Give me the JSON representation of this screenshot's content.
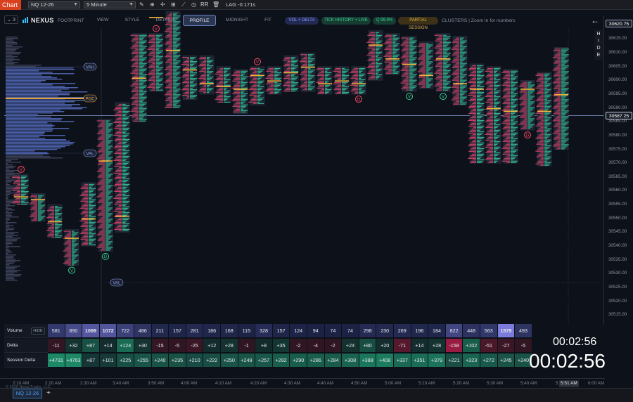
{
  "topbar": {
    "chart_tab": "Chart",
    "symbol": "NQ 12-26",
    "interval": "5 Minute",
    "lag": "LAG -0.171s",
    "rr": "RR"
  },
  "toolbar": {
    "version_btn": "3",
    "brand": "NEXUS",
    "brand_sub": "FOOTPRINT",
    "buttons": [
      {
        "label": "VIEW",
        "active": false
      },
      {
        "label": "STYLE",
        "active": false
      },
      {
        "label": "DETAILS",
        "active": false
      },
      {
        "label": "PROFILE",
        "active": true
      },
      {
        "label": "MIDNIGHT",
        "active": false
      },
      {
        "label": "FIT",
        "active": false
      }
    ],
    "pills": [
      {
        "label": "VOL + DELTA",
        "color": "#6a78ff",
        "bg": "#232a52"
      },
      {
        "label": "TICK HISTORY + LIVE",
        "color": "#3fd39a",
        "bg": "#173d33"
      },
      {
        "label": "Q 99.9%",
        "color": "#3fd39a",
        "bg": "#173d33"
      },
      {
        "label": "PARTIAL SESSION",
        "color": "#e3b24a",
        "bg": "#3d3218"
      }
    ],
    "clusters_text": "CLUSTERS | Zoom in for numbers"
  },
  "side": {
    "hide": "H\nI\nD\nE"
  },
  "price_axis": {
    "ticks": [
      "30615.00",
      "30610.00",
      "30605.00",
      "30600.00",
      "30595.00",
      "30590.00",
      "30585.00",
      "30580.00",
      "30575.00",
      "30570.00",
      "30565.00",
      "30560.00",
      "30555.00",
      "30550.00",
      "30545.00",
      "30540.00",
      "30535.00",
      "30530.00",
      "30525.00",
      "30520.00",
      "30515.00"
    ],
    "top_tag": "30620.75",
    "current_tag": "30587.25"
  },
  "profile_labels": {
    "vah": "VAH",
    "poc": "POC",
    "val": "VAL",
    "val2": "VAL"
  },
  "stats": {
    "labels": {
      "volume": "Volume",
      "hide": "HIDE",
      "delta": "Delta",
      "session_delta": "Session Delta"
    },
    "volume": [
      "581",
      "890",
      "1099",
      "1072",
      "722",
      "486",
      "211",
      "157",
      "281",
      "186",
      "168",
      "115",
      "328",
      "157",
      "124",
      "94",
      "74",
      "74",
      "298",
      "230",
      "269",
      "196",
      "184",
      "822",
      "448",
      "563",
      "1579",
      "493"
    ],
    "delta": [
      "-11",
      "+32",
      "+87",
      "+14",
      "+124",
      "+30",
      "-15",
      "-5",
      "-25",
      "+12",
      "+28",
      "-1",
      "+8",
      "+35",
      "-2",
      "-4",
      "-2",
      "+24",
      "+80",
      "+20",
      "-71",
      "+14",
      "+28",
      "-158",
      "+102",
      "-51",
      "-27",
      "-5"
    ],
    "session_delta": [
      "+4731",
      "+4763",
      "+87",
      "+101",
      "+225",
      "+255",
      "+240",
      "+235",
      "+210",
      "+222",
      "+250",
      "+249",
      "+257",
      "+292",
      "+290",
      "+286",
      "+284",
      "+308",
      "+388",
      "+408",
      "+337",
      "+351",
      "+379",
      "+221",
      "+323",
      "+272",
      "+245",
      "+240"
    ]
  },
  "clocks": {
    "small": "00:02:56",
    "big": "00:02:56"
  },
  "time_axis": {
    "ticks": [
      "2:10 AM",
      "2:20 AM",
      "2:30 AM",
      "3:40 AM",
      "3:50 AM",
      "4:00 AM",
      "4:10 AM",
      "4:20 AM",
      "4:30 AM",
      "4:40 AM",
      "4:50 AM",
      "5:00 AM",
      "5:10 AM",
      "5:20 AM",
      "5:30 AM",
      "5:40 AM",
      "5:50 AM",
      "6:00 AM"
    ],
    "current": "5:51 AM"
  },
  "footer": {
    "tab": "NQ 12-26",
    "add": "+"
  },
  "copyright": "© 2026 NexusTrader, LLC",
  "chart_data": {
    "type": "footprint",
    "price_range": [
      30512,
      30622
    ],
    "current_price": 30587.25,
    "candles": [
      {
        "high": 30566,
        "low": 30555,
        "poc": 30558,
        "marker": "V"
      },
      {
        "high": 30559,
        "low": 30549,
        "poc": 30557
      },
      {
        "high": 30555,
        "low": 30543,
        "poc": 30549
      },
      {
        "high": 30546,
        "low": 30533,
        "poc": 30543,
        "marker": "V"
      },
      {
        "high": 30563,
        "low": 30540,
        "poc": 30550
      },
      {
        "high": 30586,
        "low": 30538,
        "poc": 30571,
        "marker": "D"
      },
      {
        "high": 30592,
        "low": 30545,
        "poc": 30551
      },
      {
        "high": 30617,
        "low": 30585,
        "poc": 30601
      },
      {
        "high": 30617,
        "low": 30596,
        "poc": 30623,
        "marker": "V"
      },
      {
        "high": 30625,
        "low": 30590,
        "poc": 30611
      },
      {
        "high": 30609,
        "low": 30593,
        "poc": 30604
      },
      {
        "high": 30609,
        "low": 30595,
        "poc": 30599
      },
      {
        "high": 30605,
        "low": 30592,
        "poc": 30598
      },
      {
        "high": 30604,
        "low": 30588,
        "poc": 30597
      },
      {
        "high": 30605,
        "low": 30591,
        "poc": 30602,
        "marker": "V"
      },
      {
        "high": 30605,
        "low": 30595,
        "poc": 30600
      },
      {
        "high": 30609,
        "low": 30596,
        "poc": 30603
      },
      {
        "high": 30610,
        "low": 30596,
        "poc": 30605
      },
      {
        "high": 30605,
        "low": 30595,
        "poc": 30599
      },
      {
        "high": 30605,
        "low": 30595,
        "poc": 30600
      },
      {
        "high": 30605,
        "low": 30595,
        "poc": 30599,
        "marker": "D"
      },
      {
        "high": 30618,
        "low": 30600,
        "poc": 30613
      },
      {
        "high": 30617,
        "low": 30602,
        "poc": 30608
      },
      {
        "high": 30616,
        "low": 30596,
        "poc": 30606,
        "marker": "V"
      },
      {
        "high": 30614,
        "low": 30597,
        "poc": 30602
      },
      {
        "high": 30617,
        "low": 30596,
        "poc": 30608,
        "marker": "V"
      },
      {
        "high": 30616,
        "low": 30591,
        "poc": 30599
      },
      {
        "high": 30606,
        "low": 30570,
        "poc": 30597
      },
      {
        "high": 30605,
        "low": 30570,
        "poc": 30590
      },
      {
        "high": 30604,
        "low": 30570,
        "poc": 30589
      },
      {
        "high": 30600,
        "low": 30582,
        "poc": 30597,
        "marker": "D"
      },
      {
        "high": 30603,
        "low": 30569,
        "poc": 30589
      },
      {
        "high": 30612,
        "low": 30575,
        "poc": 30595
      }
    ]
  }
}
